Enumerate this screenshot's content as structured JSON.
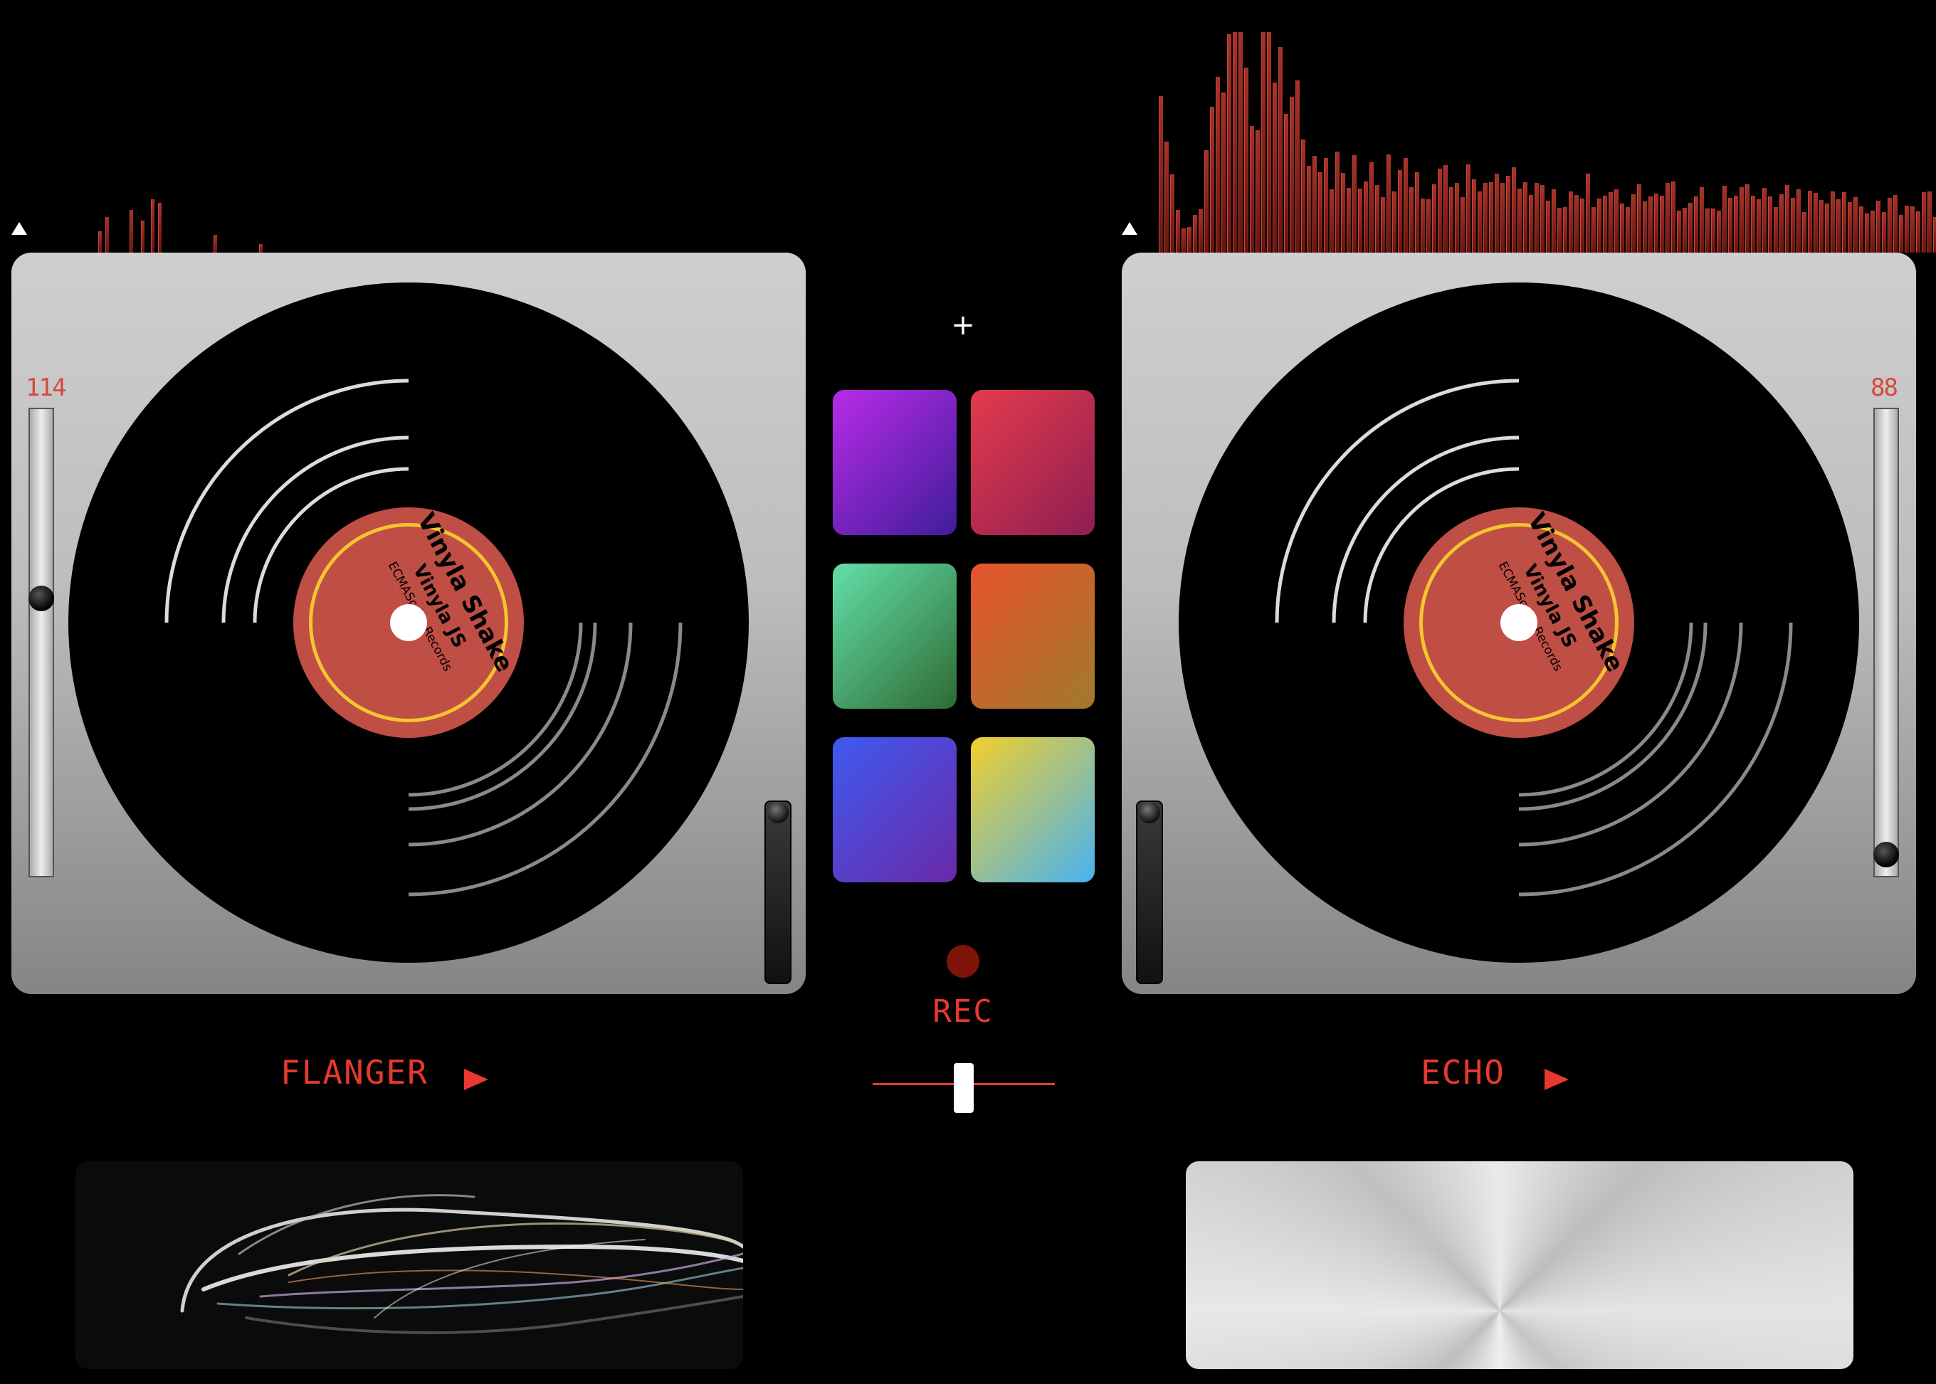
{
  "app": {
    "deck_label": {
      "title": "Vinyla Shake",
      "artist": "Vinyla JS",
      "company": "ECMAScript Records"
    }
  },
  "deck_left": {
    "pitch_value": "114",
    "pitch_level": 0.4,
    "volume_level": 1.0,
    "effect_name": "FLANGER"
  },
  "deck_right": {
    "pitch_value": "88",
    "pitch_level": 0.98,
    "volume_level": 1.0,
    "effect_name": "ECHO"
  },
  "center": {
    "add_label": "+",
    "rec_label": "REC",
    "crossfader_level": 0.5,
    "pads": [
      {
        "name": "pad-purple",
        "from": "#b82be8",
        "to": "#3f1d9a"
      },
      {
        "name": "pad-red",
        "from": "#e43a4c",
        "to": "#8e1f52"
      },
      {
        "name": "pad-green",
        "from": "#62e0a8",
        "to": "#2f6a34"
      },
      {
        "name": "pad-orange",
        "from": "#e8532d",
        "to": "#a07a2c"
      },
      {
        "name": "pad-blue",
        "from": "#3f5af0",
        "to": "#6a2aa8"
      },
      {
        "name": "pad-rainbow",
        "from": "#f2cf2c",
        "to": "#48b2f2"
      }
    ]
  },
  "colors": {
    "accent_red": "#e8382f",
    "label_red": "#bf4e45",
    "label_ring": "#f4c531"
  }
}
